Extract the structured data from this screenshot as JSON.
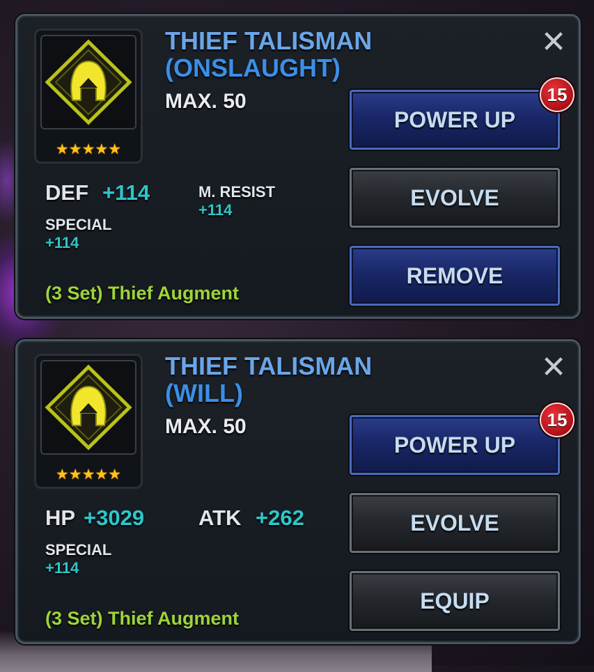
{
  "colors": {
    "title_blue": "#6aa6e8",
    "stat_teal": "#2ec6c9",
    "augment_green": "#9ed43a",
    "badge_red": "#b5121a",
    "star_gold": "#ffc21c"
  },
  "cards": [
    {
      "icon": "thief-talisman-icon",
      "stars": "★★★★★",
      "title_line1": "THIEF TALISMAN",
      "title_line2": "(ONSLAUGHT)",
      "max_level": "MAX. 50",
      "close_icon": "✕",
      "stats": [
        {
          "label": "DEF",
          "value": "+114"
        },
        {
          "label": "M. RESIST",
          "value": "+114"
        },
        {
          "label": "SPECIAL",
          "value": "+114"
        }
      ],
      "set_bonus": "(3 Set) Thief Augment",
      "buttons": [
        {
          "label": "POWER UP",
          "style": "blue"
        },
        {
          "label": "EVOLVE",
          "style": "dark"
        },
        {
          "label": "REMOVE",
          "style": "blue"
        }
      ],
      "badge": "15"
    },
    {
      "icon": "thief-talisman-icon",
      "stars": "★★★★★",
      "title_line1": "THIEF TALISMAN",
      "title_line2": "(WILL)",
      "max_level": "MAX. 50",
      "close_icon": "✕",
      "stats": [
        {
          "label": "HP",
          "value": "+3029"
        },
        {
          "label": "ATK",
          "value": "+262"
        },
        {
          "label": "SPECIAL",
          "value": "+114"
        }
      ],
      "set_bonus": "(3 Set) Thief Augment",
      "buttons": [
        {
          "label": "POWER UP",
          "style": "blue"
        },
        {
          "label": "EVOLVE",
          "style": "dark"
        },
        {
          "label": "EQUIP",
          "style": "dark"
        }
      ],
      "badge": "15"
    }
  ]
}
